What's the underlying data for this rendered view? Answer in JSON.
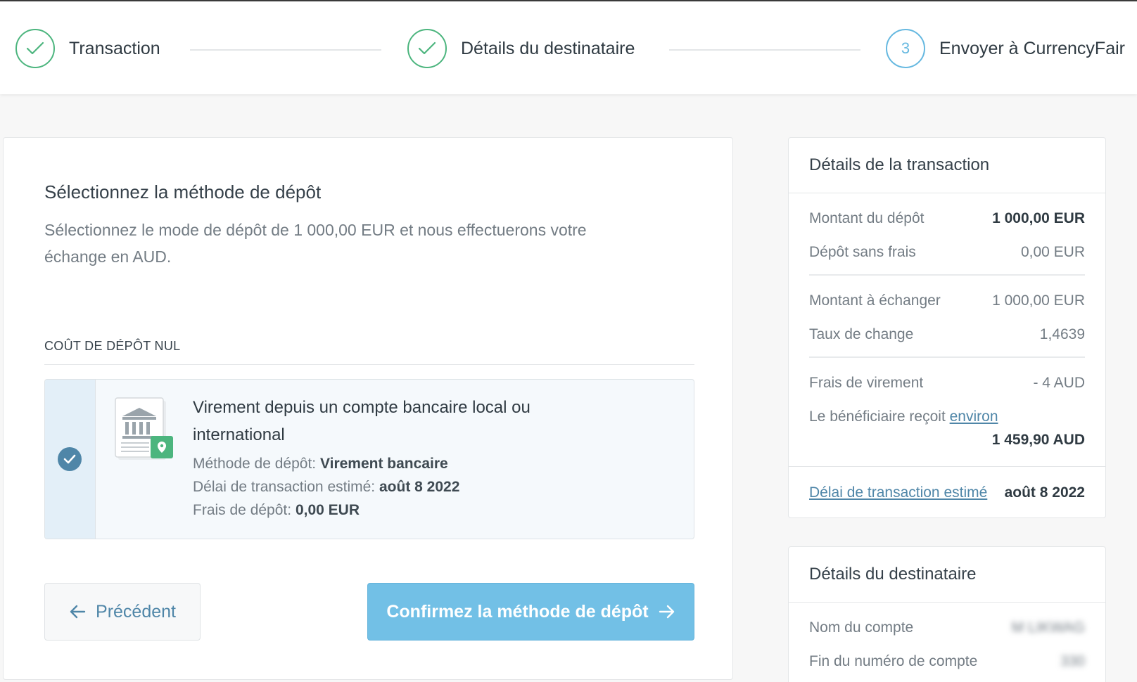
{
  "stepper": {
    "steps": [
      {
        "label": "Transaction",
        "state": "done"
      },
      {
        "label": "Détails du destinataire",
        "state": "done"
      },
      {
        "number": "3",
        "label": "Envoyer à CurrencyFair",
        "state": "current"
      }
    ]
  },
  "main": {
    "title": "Sélectionnez la méthode de dépôt",
    "description": "Sélectionnez le mode de dépôt de 1 000,00 EUR et nous effectuerons votre échange en AUD.",
    "section_label": "COÛT DE DÉPÔT NUL",
    "option": {
      "title": "Virement depuis un compte bancaire local ou international",
      "method_label": "Méthode de dépôt:",
      "method_value": "Virement bancaire",
      "delay_label": "Délai de transaction estimé:",
      "delay_value": "août 8 2022",
      "fee_label": "Frais de dépôt:",
      "fee_value": "0,00 EUR",
      "selected": true
    },
    "buttons": {
      "previous": "Précédent",
      "confirm": "Confirmez la méthode de dépôt"
    }
  },
  "transaction_details": {
    "title": "Détails de la transaction",
    "deposit_amount_label": "Montant du dépôt",
    "deposit_amount_value": "1 000,00 EUR",
    "free_deposit_label": "Dépôt sans frais",
    "free_deposit_value": "0,00 EUR",
    "exchange_amount_label": "Montant à échanger",
    "exchange_amount_value": "1 000,00 EUR",
    "rate_label": "Taux de change",
    "rate_value": "1,4639",
    "transfer_fee_label": "Frais de virement",
    "transfer_fee_value": "- 4 AUD",
    "receives_label": "Le bénéficiaire reçoit",
    "receives_link": "environ",
    "receives_value": "1 459,90 AUD",
    "estimated_delay_link": "Délai de transaction estimé",
    "estimated_delay_value": "août 8 2022"
  },
  "recipient_details": {
    "title": "Détails du destinataire",
    "account_name_label": "Nom du compte",
    "account_name_value": "M LIKWAG",
    "account_end_label": "Fin du numéro de compte",
    "account_end_value": "330"
  },
  "colors": {
    "done_green": "#4cb57e",
    "current_blue": "#65b8e0",
    "primary_button": "#72c0e6",
    "link_blue": "#4f86a8"
  }
}
